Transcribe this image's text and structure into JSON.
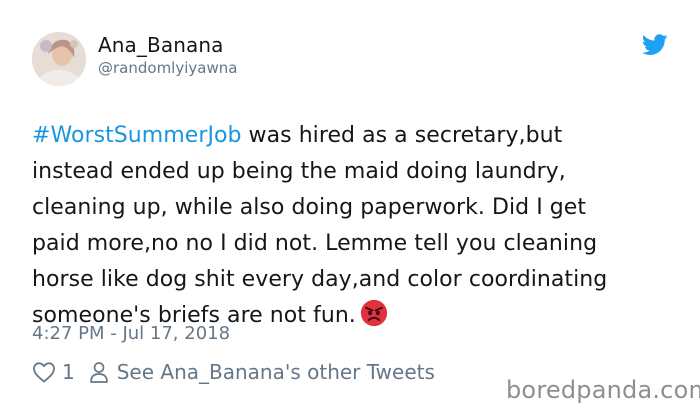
{
  "user": {
    "display_name": "Ana_Banana",
    "handle": "@randomlyiyawna",
    "avatar_icon": "profile-photo"
  },
  "tweet": {
    "hashtag": "#WorstSummerJob",
    "lines": [
      " was hired as a secretary,but",
      "instead ended up being the maid doing laundry,",
      "cleaning up, while also doing paperwork. Did I get",
      "paid more,no no I did not. Lemme tell you cleaning",
      "horse like dog shit every day,and color coordinating",
      "someone's briefs are not fun."
    ],
    "emoji": "angry-face",
    "timestamp": "4:27 PM - Jul 17, 2018"
  },
  "actions": {
    "like_count": "1",
    "other_tweets_label": "See Ana_Banana's other Tweets"
  },
  "watermark": "boredpanda.com",
  "colors": {
    "hashtag": "#1b95e0",
    "twitter_blue": "#1da1f2",
    "muted": "#657786",
    "angry_red": "#e0313d"
  }
}
